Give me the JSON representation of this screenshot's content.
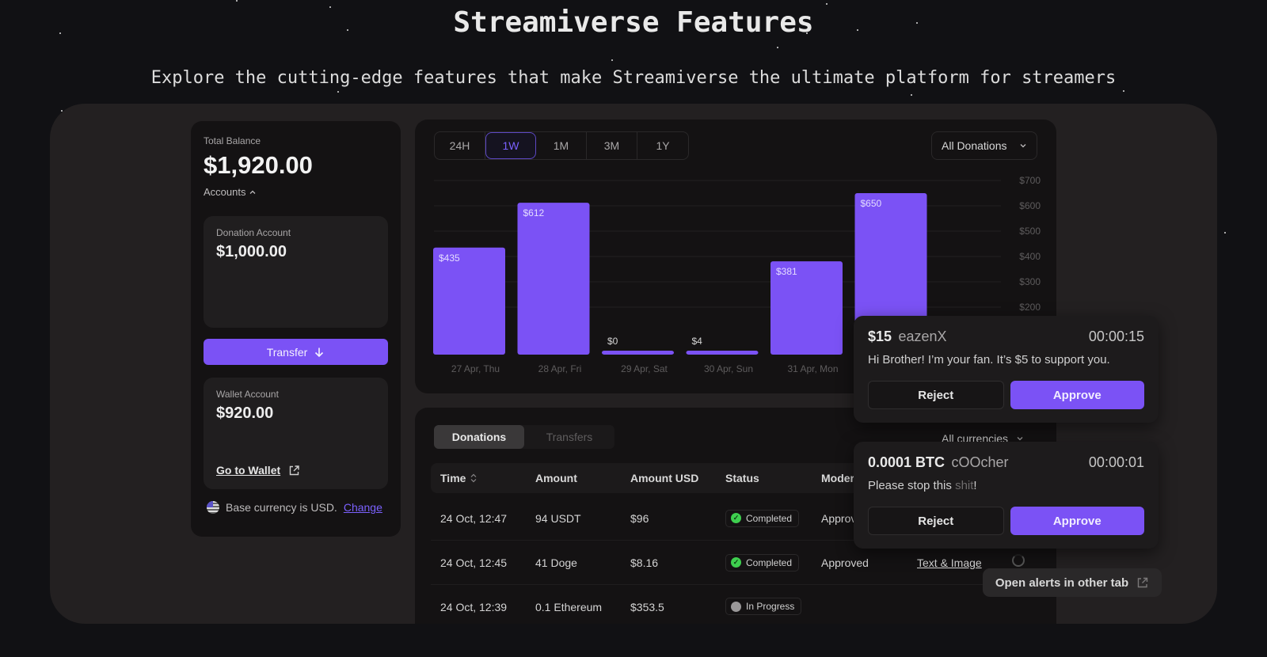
{
  "header": {
    "title": "Streamiverse Features",
    "subtitle": "Explore the cutting-edge features that make Streamiverse the ultimate platform for streamers"
  },
  "balance": {
    "total_label": "Total Balance",
    "total_value": "$1,920.00",
    "accounts_label": "Accounts",
    "donation_account": {
      "label": "Donation Account",
      "value": "$1,000.00"
    },
    "transfer_label": "Transfer",
    "wallet_account": {
      "label": "Wallet Account",
      "value": "$920.00",
      "link_label": "Go to Wallet"
    },
    "base_currency_text": "Base currency is USD.",
    "change_label": "Change"
  },
  "chart_panel": {
    "ranges": [
      "24H",
      "1W",
      "1M",
      "3M",
      "1Y"
    ],
    "active_range": "1W",
    "filter_value": "All Donations"
  },
  "chart_data": {
    "type": "bar",
    "title": "",
    "xlabel": "",
    "ylabel": "",
    "categories": [
      "27 Apr, Thu",
      "28 Apr, Fri",
      "29 Apr, Sat",
      "30 Apr, Sun",
      "31 Apr, Mon",
      ""
    ],
    "values": [
      435,
      612,
      0,
      4,
      381,
      650
    ],
    "value_labels": [
      "$435",
      "$612",
      "$0",
      "$4",
      "$381",
      "$650"
    ],
    "y_ticks": [
      "$700",
      "$600",
      "$500",
      "$400",
      "$300",
      "$200"
    ],
    "y_tick_values": [
      700,
      600,
      500,
      400,
      300,
      200
    ],
    "ylim": [
      0,
      700
    ],
    "grid": true,
    "bar_color": "#7b52f5"
  },
  "table_panel": {
    "tabs": [
      "Donations",
      "Transfers"
    ],
    "active_tab": "Donations",
    "currency_filter": "All currencies",
    "columns": [
      "Time",
      "Amount",
      "Amount USD",
      "Status",
      "Moder"
    ],
    "rows": [
      {
        "time": "24 Oct, 12:47",
        "amount": "94 USDT",
        "usd": "$96",
        "status": "Completed",
        "moderation": "Approv",
        "type": ""
      },
      {
        "time": "24 Oct, 12:45",
        "amount": "41 Doge",
        "usd": "$8.16",
        "status": "Completed",
        "moderation": "Approved",
        "type": "Text & Image"
      },
      {
        "time": "24 Oct, 12:39",
        "amount": "0.1 Ethereum",
        "usd": "$353.5",
        "status": "In Progress",
        "moderation": "",
        "type": ""
      }
    ]
  },
  "alerts": [
    {
      "amount": "$15",
      "user": "eazenX",
      "timer": "00:00:15",
      "message": "Hi Brother! I’m your fan. It’s $5 to support you.",
      "censored": "",
      "message_end": "",
      "reject_label": "Reject",
      "approve_label": "Approve"
    },
    {
      "amount": "0.0001 BTC",
      "user": "cOOcher",
      "timer": "00:00:01",
      "message": "Please stop this ",
      "censored": "shit",
      "message_end": "!",
      "reject_label": "Reject",
      "approve_label": "Approve"
    }
  ],
  "open_alerts_label": "Open alerts in other tab",
  "colors": {
    "accent": "#7b52f5",
    "link": "#7b61ff",
    "success": "#3ecf4f",
    "background": "#111114",
    "stage": "#232021",
    "panel": "#141213"
  }
}
